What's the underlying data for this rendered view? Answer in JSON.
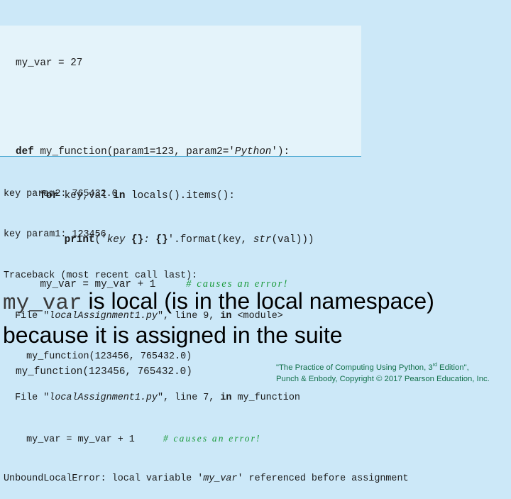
{
  "code": {
    "l1": {
      "a": "my_var = 27"
    },
    "l3": {
      "kw": "def",
      "a": " my_function(param1=123, param2='",
      "it": "Python",
      "b": "'):"
    },
    "l4": {
      "indent": "    ",
      "kw1": "for",
      "a": " key,val ",
      "kw2": "in",
      "b": " locals().items():"
    },
    "l5": {
      "indent": "        ",
      "kw": "print",
      "a": "('",
      "it1": "key ",
      "br1": "{}",
      "it2": ": ",
      "br2": "{}",
      "b": "'.format(key, ",
      "it3": "str",
      "c": "(val)))"
    },
    "l6": {
      "a": "    my_var = my_var + 1     ",
      "comment": "# causes an error!"
    },
    "l8": {
      "a": "my_function(123456, 765432.0)"
    }
  },
  "output": {
    "l1": "key param2: 765432.0",
    "l2": "key param1: 123456",
    "l3": "Traceback (most recent call last):",
    "l4": {
      "a": "  File \"",
      "it": "localAssignment1.py",
      "b": "\", line 9, ",
      "kw": "in",
      "c": " <module>"
    },
    "l5": "    my_function(123456, 765432.0)",
    "l6": {
      "a": "  File \"",
      "it": "localAssignment1.py",
      "b": "\", line 7, ",
      "kw": "in",
      "c": " my_function"
    },
    "l7": {
      "a": "    my_var = my_var + 1     ",
      "comment": "# causes an error!"
    },
    "l8": {
      "a": "UnboundLocalError: local variable '",
      "it": "my_var",
      "b": "' referenced before assignment"
    }
  },
  "statement": {
    "mono": "my_var",
    "line1_rest": " is local (is in the local namespace)",
    "line2": "because it is assigned in the suite"
  },
  "credit": {
    "line1_a": "\"The Practice of Computing Using Python, 3",
    "line1_sup": "rd",
    "line1_b": " Edition\",",
    "line2": "Punch & Enbody, Copyright © 2017 Pearson Education, Inc."
  },
  "colors": {
    "background": "#cce8f8",
    "code_box": "#e4f3fa",
    "comment": "#1a9a3a",
    "credit": "#12704a"
  }
}
